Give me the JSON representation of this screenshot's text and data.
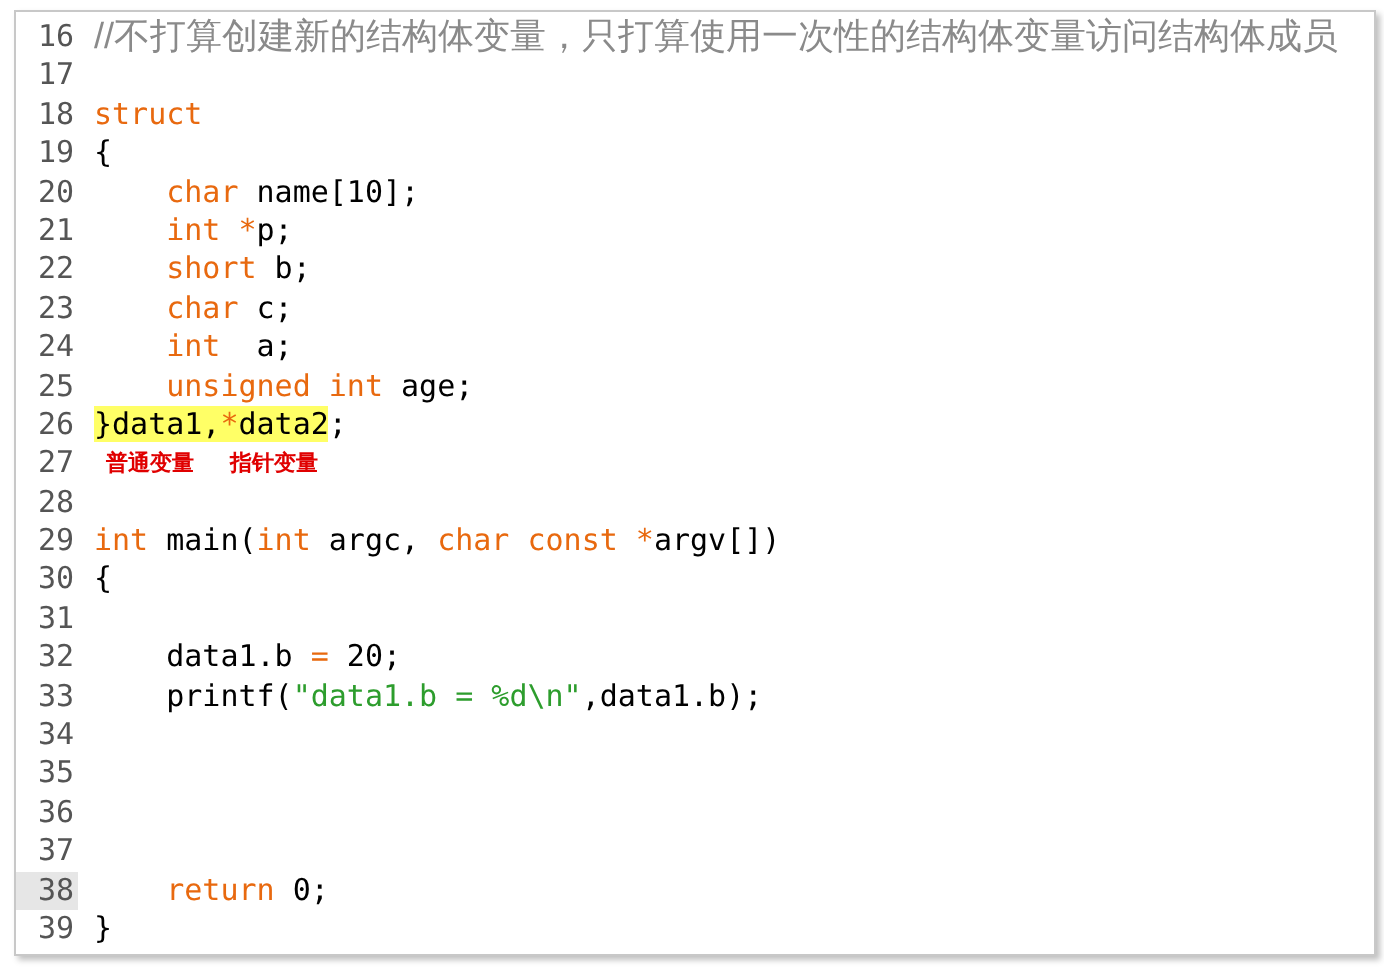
{
  "editor": {
    "lines": [
      {
        "number": "16",
        "current": false,
        "tokens": [
          {
            "text": "//不打算创建新的结构体变量，只打算使用一次性的结构体变量访问结构体成员",
            "kind": "comment"
          }
        ]
      },
      {
        "number": "17",
        "current": false
      },
      {
        "number": "18",
        "current": false,
        "tokens": [
          {
            "text": "struct",
            "kind": "keyword"
          }
        ]
      },
      {
        "number": "19",
        "current": false,
        "tokens": [
          {
            "text": "{",
            "kind": "plain"
          }
        ]
      },
      {
        "number": "20",
        "current": false,
        "tokens": [
          {
            "text": "    char",
            "kind": "keyword"
          },
          {
            "text": " name[10];",
            "kind": "plain"
          }
        ]
      },
      {
        "number": "21",
        "current": false,
        "tokens": [
          {
            "text": "    int",
            "kind": "keyword"
          },
          {
            "text": " *",
            "kind": "operator"
          },
          {
            "text": "p;",
            "kind": "plain"
          }
        ]
      },
      {
        "number": "22",
        "current": false,
        "tokens": [
          {
            "text": "    short",
            "kind": "keyword"
          },
          {
            "text": " b;",
            "kind": "plain"
          }
        ]
      },
      {
        "number": "23",
        "current": false,
        "tokens": [
          {
            "text": "    char",
            "kind": "keyword"
          },
          {
            "text": " c;",
            "kind": "plain"
          }
        ]
      },
      {
        "number": "24",
        "current": false,
        "tokens": [
          {
            "text": "    int",
            "kind": "keyword"
          },
          {
            "text": "  a;",
            "kind": "plain"
          }
        ]
      },
      {
        "number": "25",
        "current": false,
        "tokens": [
          {
            "text": "    unsigned int",
            "kind": "keyword"
          },
          {
            "text": " age;",
            "kind": "plain"
          }
        ]
      },
      {
        "number": "26",
        "current": false,
        "tokens": [
          {
            "text": "}data1,",
            "kind": "plain",
            "highlighted": true
          },
          {
            "text": "*",
            "kind": "operator",
            "highlighted": true
          },
          {
            "text": "data2",
            "kind": "plain",
            "highlighted": true
          },
          {
            "text": ";",
            "kind": "plain",
            "highlighted": false
          }
        ]
      },
      {
        "number": "27",
        "current": false,
        "notes": [
          "普通变量",
          "指针变量"
        ]
      },
      {
        "number": "28",
        "current": false
      },
      {
        "number": "29",
        "current": false,
        "tokens": [
          {
            "text": "int",
            "kind": "keyword"
          },
          {
            "text": " main(",
            "kind": "plain"
          },
          {
            "text": "int",
            "kind": "keyword"
          },
          {
            "text": " argc, ",
            "kind": "plain"
          },
          {
            "text": "char const",
            "kind": "keyword"
          },
          {
            "text": " *",
            "kind": "operator"
          },
          {
            "text": "argv[])",
            "kind": "plain"
          }
        ]
      },
      {
        "number": "30",
        "current": false,
        "tokens": [
          {
            "text": "{",
            "kind": "plain"
          }
        ]
      },
      {
        "number": "31",
        "current": false
      },
      {
        "number": "32",
        "current": false,
        "tokens": [
          {
            "text": "    data1.b ",
            "kind": "plain"
          },
          {
            "text": "=",
            "kind": "operator"
          },
          {
            "text": " 20;",
            "kind": "plain"
          }
        ]
      },
      {
        "number": "33",
        "current": false,
        "tokens": [
          {
            "text": "    printf(",
            "kind": "plain"
          },
          {
            "text": "\"data1.b = %d\\n\"",
            "kind": "string"
          },
          {
            "text": ",data1.b);",
            "kind": "plain"
          }
        ]
      },
      {
        "number": "34",
        "current": false
      },
      {
        "number": "35",
        "current": false
      },
      {
        "number": "36",
        "current": false
      },
      {
        "number": "37",
        "current": false
      },
      {
        "number": "38",
        "current": true,
        "tokens": [
          {
            "text": "    return",
            "kind": "keyword"
          },
          {
            "text": " 0;",
            "kind": "plain"
          }
        ]
      },
      {
        "number": "39",
        "current": false,
        "tokens": [
          {
            "text": "}",
            "kind": "plain"
          }
        ]
      }
    ]
  }
}
